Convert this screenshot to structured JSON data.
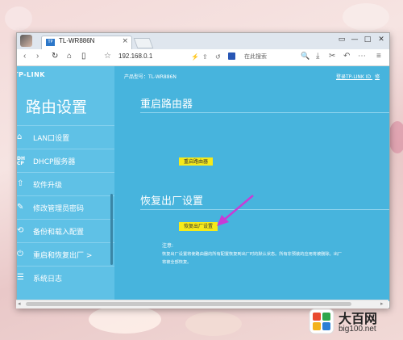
{
  "browser": {
    "tab_title": "TL-WR886N",
    "tab_favicon": "TP",
    "tab_close": "×",
    "url": "192.168.0.1",
    "search_placeholder": "在此搜索",
    "icons": [
      "back-icon",
      "forward-icon",
      "reload-icon",
      "home-icon",
      "reader-icon",
      "bookmark-star-icon",
      "lightning-icon",
      "share-icon",
      "sync-icon",
      "search-icon",
      "cut-icon",
      "download-icon",
      "tools-icon",
      "undo-icon",
      "menu-icon"
    ],
    "window_controls": [
      "restore-icon",
      "minimize-icon",
      "maximize-icon",
      "close-icon"
    ]
  },
  "router": {
    "logo": "TP-LINK",
    "sidebar_title": "路由设置",
    "model_label": "产品型号：TL-WR886N",
    "login_link": "登录TP-LINK ID",
    "login_link_extra": "修",
    "nav": [
      {
        "label": "LAN口设置",
        "icon": "home-icon"
      },
      {
        "label": "DHCP服务器",
        "icon": "dhcp-icon"
      },
      {
        "label": "软件升级",
        "icon": "upload-icon"
      },
      {
        "label": "修改管理员密码",
        "icon": "pencil-icon"
      },
      {
        "label": "备份和载入配置",
        "icon": "backup-icon"
      },
      {
        "label": "重启和恢复出厂  >",
        "icon": "power-icon"
      },
      {
        "label": "系统日志",
        "icon": "list-icon"
      }
    ],
    "restart": {
      "title": "重启路由器",
      "button": "重启路由器"
    },
    "reset": {
      "title": "恢复出厂设置",
      "button": "恢复出厂设置",
      "note_label": "注意:",
      "note_line1": "恢复出厂设置将使路由器的所有配置恢复到出厂时的默认状态。所有非预装的应用将被删除。出厂",
      "note_line2": "将被全部恢复。"
    },
    "colors": {
      "page_bg": "#47b4dd",
      "sidebar_bg": "#5fc1e6",
      "button_yellow": "#f6ea1a",
      "arrow": "#c83cd6"
    }
  },
  "watermark": {
    "big": "大百网",
    "small": "big100.net"
  }
}
